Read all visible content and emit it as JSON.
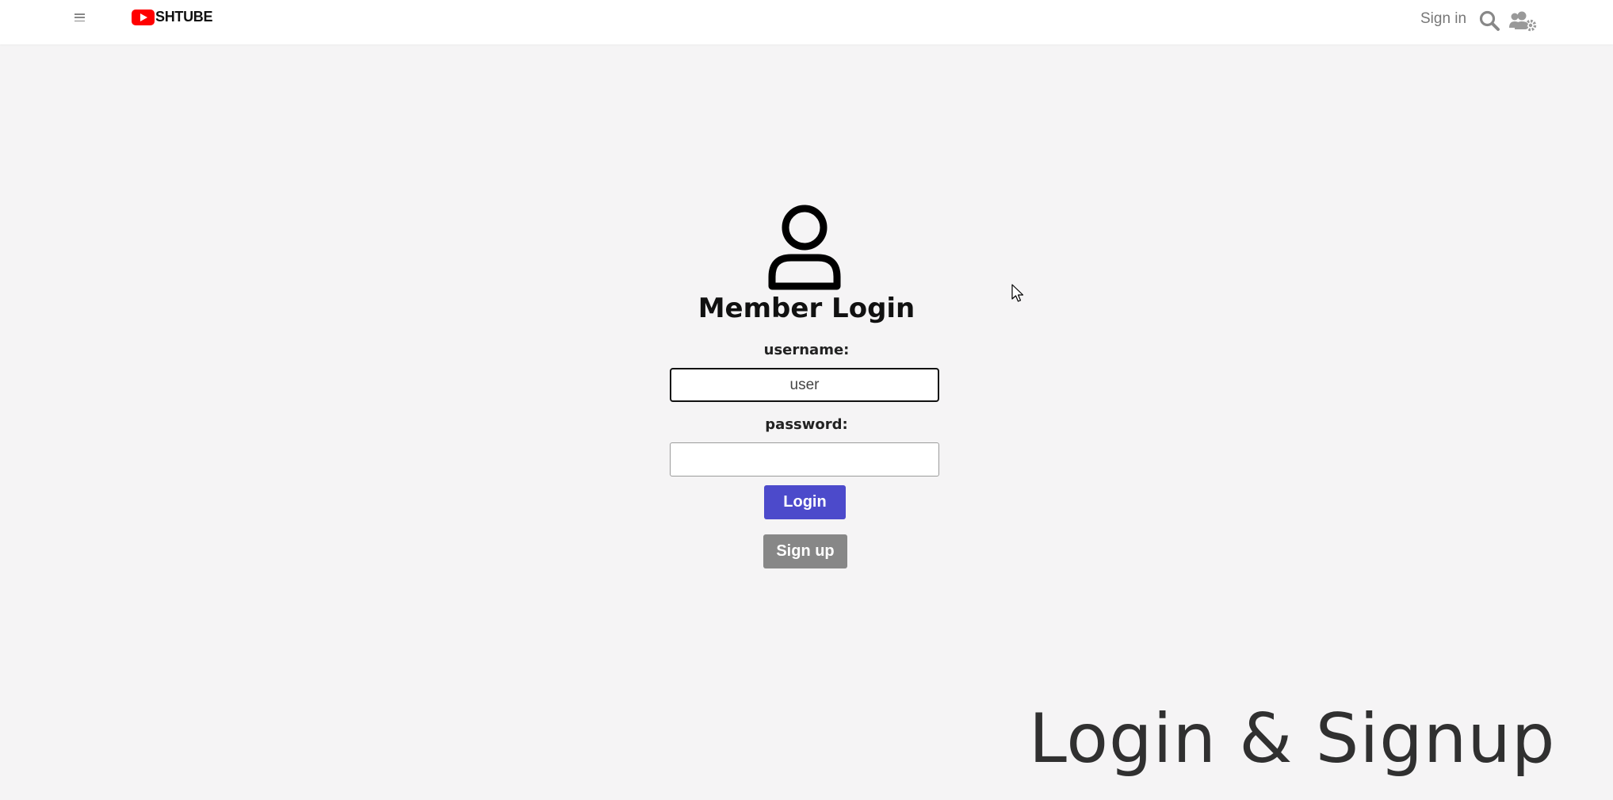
{
  "header": {
    "logo_text": "SHTUBE",
    "logo_color": "#ff0000",
    "signin_label": "Sign in",
    "icons": [
      "hamburger-menu-icon",
      "search-icon",
      "users-gear-icon"
    ]
  },
  "login": {
    "title": "Member Login",
    "username_label": "username:",
    "username_value": "user",
    "password_label": "password:",
    "password_value": "",
    "login_button": "Login",
    "signup_button": "Sign up",
    "login_color": "#4c4acb",
    "signup_color": "#878787"
  },
  "caption": "Login & Signup"
}
